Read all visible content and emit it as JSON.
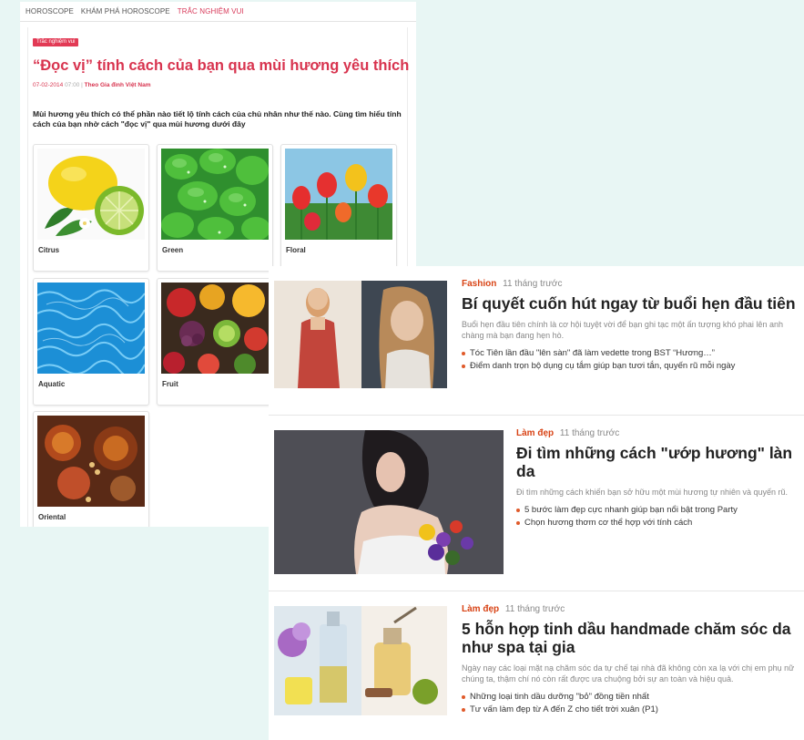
{
  "left": {
    "nav": [
      "HOROSCOPE",
      "KHÁM PHÁ HOROSCOPE",
      "TRẮC NGHIỆM VUI"
    ],
    "badge": "Trắc nghiệm vui",
    "title": "“Đọc vị” tính cách của bạn qua mùi hương yêu thích",
    "date": "07-02-2014",
    "time": "07:00",
    "source": "Theo Gia đình Việt Nam",
    "intro": "Mùi hương yêu thích có thể phần nào tiết lộ tính cách của chủ nhân như thế nào. Cùng tìm hiểu tính cách của bạn nhờ cách \"đọc vị\" qua mùi hương dưới đây",
    "cards": [
      {
        "label": "Citrus"
      },
      {
        "label": "Green"
      },
      {
        "label": "Floral"
      },
      {
        "label": "Aquatic"
      },
      {
        "label": "Fruit"
      },
      {
        "label": "Oriental"
      }
    ]
  },
  "right": {
    "items": [
      {
        "category": "Fashion",
        "ago": "11 tháng trước",
        "title": "Bí quyết cuốn hút ngay từ buổi hẹn đầu tiên",
        "desc": "Buổi hẹn đầu tiên chính là cơ hội tuyệt vời để bạn ghi tạc một ấn tượng khó phai lên anh chàng mà bạn đang hẹn hò.",
        "related": [
          "Tóc Tiên lần đầu \"lên sàn\" đã làm vedette trong BST “Hương…”",
          "Điểm danh trọn bộ dụng cụ tắm giúp bạn tươi tắn, quyến rũ mỗi ngày"
        ]
      },
      {
        "category": "Làm đẹp",
        "ago": "11 tháng trước",
        "title": "Đi tìm những cách \"ướp hương\" làn da",
        "desc": "Đi tìm những cách khiến bạn sở hữu một mùi hương tự nhiên và quyến rũ.",
        "related": [
          "5 bước làm đẹp cực nhanh giúp bạn nổi bật trong Party",
          "Chọn hương thơm cơ thể hợp với tính cách"
        ]
      },
      {
        "category": "Làm đẹp",
        "ago": "11 tháng trước",
        "title": "5 hỗn hợp tinh dầu handmade chăm sóc da như spa tại gia",
        "desc": "Ngày nay các loại mặt nạ chăm sóc da tự chế tại nhà đã không còn xa lạ với chị em phụ nữ chúng ta, thậm chí nó còn rất được ưa chuộng bởi sự an toàn và hiệu quả.",
        "related": [
          "Những loại tinh dầu dưỡng \"bỏ\" đồng tiền nhất",
          "Tư vấn làm đẹp từ A đến Z cho tiết trời xuân (P1)"
        ]
      }
    ]
  },
  "colors": {
    "accent": "#d8344f",
    "category": "#d84315",
    "bullet": "#e05a2a"
  }
}
